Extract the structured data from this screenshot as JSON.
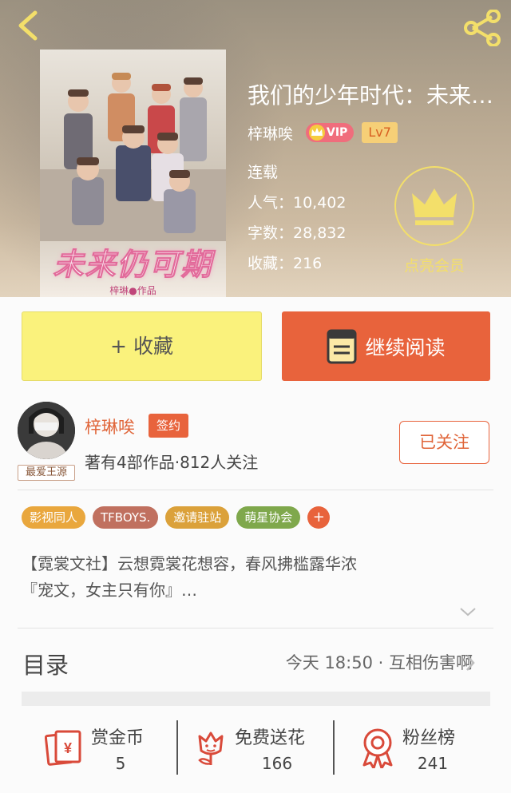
{
  "header": {
    "book_title": "我们的少年时代：未来仍可期",
    "author": "梓琳唉",
    "vip": "VIP",
    "level": "Lv7",
    "status": "连载",
    "popularity": "人气：10,402",
    "word_count": "字数：28,832",
    "favorites": "收藏：216",
    "member_label": "点亮会员",
    "cover": {
      "title": "未来仍可期",
      "author": "梓琳●作品"
    }
  },
  "actions": {
    "favorite_label": "+ 收藏",
    "continue_label": "继续阅读"
  },
  "author_card": {
    "name": "梓琳唉",
    "badge": "签约",
    "avatar_tag": "最爱王源",
    "info": "著有4部作品·812人关注",
    "follow_label": "已关注"
  },
  "tags": [
    {
      "label": "影视同人",
      "color": "#e9a73d"
    },
    {
      "label": "TFBOYS.",
      "color": "#c0705f"
    },
    {
      "label": "邀请驻站",
      "color": "#dba13a"
    },
    {
      "label": "萌星协会",
      "color": "#7fa84c"
    }
  ],
  "tag_more": "+",
  "description": {
    "line1": "【霓裳文社】云想霓裳花想容，春风拂槛露华浓",
    "line2": "『宠文，女主只有你』…"
  },
  "toc": {
    "title": "目录",
    "latest": "今天 18:50 · 互相伤害啊"
  },
  "bottom_stats": [
    {
      "label": "赏金币",
      "value": "5",
      "icon": "red-envelope-icon"
    },
    {
      "label": "免费送花",
      "value": "166",
      "icon": "flower-icon"
    },
    {
      "label": "粉丝榜",
      "value": "241",
      "icon": "medal-icon"
    }
  ],
  "colors": {
    "accent": "#e8633c",
    "favorite_button": "#faf27c",
    "member_gold": "#f3df6a"
  }
}
